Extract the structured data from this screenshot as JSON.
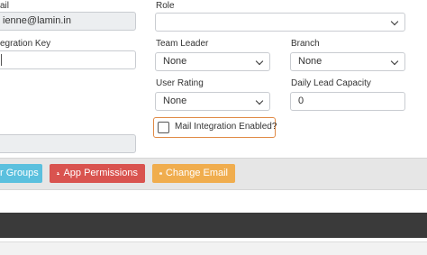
{
  "form": {
    "email_label": "ail",
    "email_value": "ienne@lamin.in",
    "integration_key_label": "egration Key",
    "role_label": "Role",
    "role_value": "",
    "team_leader_label": "Team Leader",
    "team_leader_value": "None",
    "branch_label": "Branch",
    "branch_value": "None",
    "user_rating_label": "User Rating",
    "user_rating_value": "None",
    "daily_lead_capacity_label": "Daily Lead Capacity",
    "daily_lead_capacity_value": "0",
    "mail_integration_label": "Mail Integration Enabled?"
  },
  "actions": {
    "groups_label": "r Groups",
    "app_permissions_label": "App Permissions",
    "change_email_label": "Change Email"
  },
  "colors": {
    "groups_button": "#5bc0de",
    "app_permissions_button": "#d9534f",
    "change_email_button": "#f0ad4e",
    "mail_integration_highlight": "#e08a46"
  }
}
